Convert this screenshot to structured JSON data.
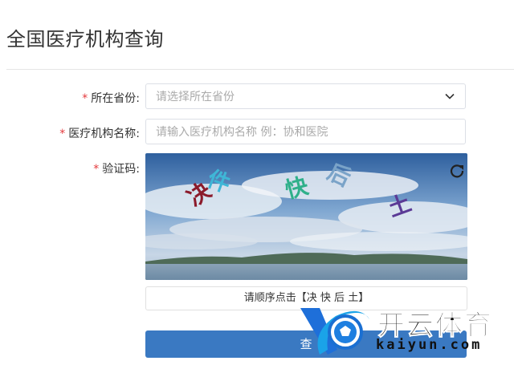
{
  "page": {
    "title": "全国医疗机构查询"
  },
  "form": {
    "province": {
      "label": "所在省份:",
      "placeholder": "请选择所在省份"
    },
    "name": {
      "label": "医疗机构名称:",
      "placeholder": "请输入医疗机构名称  例：协和医院"
    },
    "captcha": {
      "label": "验证码:",
      "chars": [
        {
          "text": "决",
          "color": "#8b1a2b"
        },
        {
          "text": "件",
          "color": "#3fb6d6"
        },
        {
          "text": "快",
          "color": "#2fb08a"
        },
        {
          "text": "后",
          "color": "#7aa3c8"
        },
        {
          "text": "土",
          "color": "#5b3a96"
        }
      ],
      "hint": "请顺序点击【决  快  后  土】"
    },
    "required_mark": "*",
    "submit_label": "查"
  },
  "watermark": {
    "brand": "开云体育",
    "url": "kaiyun.com"
  }
}
